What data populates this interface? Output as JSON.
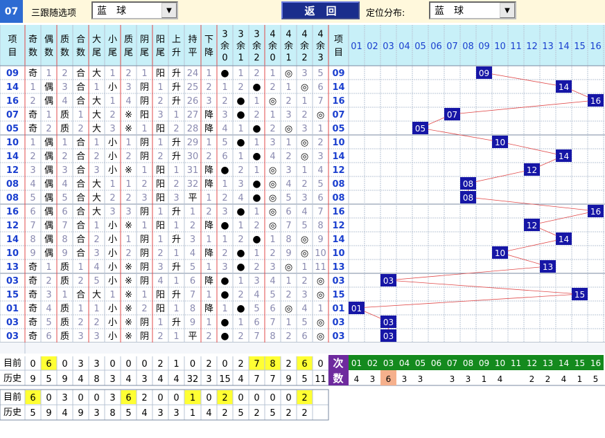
{
  "header": {
    "issue": "07",
    "filter1_label": "三跟随选项",
    "filter1_value": "蓝球",
    "back_label": "返回",
    "pos_label": "定位分布:",
    "pos_value": "蓝球"
  },
  "col_headers": [
    [
      "项",
      "目"
    ],
    [
      "奇",
      "数"
    ],
    [
      "偶",
      "数"
    ],
    [
      "质",
      "数"
    ],
    [
      "合",
      "数"
    ],
    [
      "大",
      "尾"
    ],
    [
      "小",
      "尾"
    ],
    [
      "质",
      "尾"
    ],
    [
      "阴",
      "尾"
    ],
    [
      "阳",
      "尾"
    ],
    [
      "上",
      "升"
    ],
    [
      "持",
      "平"
    ],
    [
      "下",
      "降"
    ],
    [
      "3",
      "余",
      "0"
    ],
    [
      "3",
      "余",
      "1"
    ],
    [
      "3",
      "余",
      "2"
    ],
    [
      "4",
      "余",
      "0"
    ],
    [
      "4",
      "余",
      "1"
    ],
    [
      "4",
      "余",
      "2"
    ],
    [
      "4",
      "余",
      "3"
    ],
    [
      "项",
      "目"
    ]
  ],
  "num_headers": [
    "01",
    "02",
    "03",
    "04",
    "05",
    "06",
    "07",
    "08",
    "09",
    "10",
    "11",
    "12",
    "13",
    "14",
    "15",
    "16"
  ],
  "rows": [
    [
      "09",
      "奇",
      "1",
      "2",
      "合",
      "大",
      "1",
      "2",
      "1",
      "阳",
      "升",
      "24",
      "1",
      "●",
      "1",
      "2",
      "1",
      "◎",
      "3",
      "5",
      "09"
    ],
    [
      "14",
      "1",
      "偶",
      "3",
      "合",
      "1",
      "小",
      "3",
      "阴",
      "1",
      "升",
      "25",
      "2",
      "1",
      "2",
      "●",
      "2",
      "1",
      "◎",
      "6",
      "14"
    ],
    [
      "16",
      "2",
      "偶",
      "4",
      "合",
      "大",
      "1",
      "4",
      "阴",
      "2",
      "升",
      "26",
      "3",
      "2",
      "●",
      "1",
      "◎",
      "2",
      "1",
      "7",
      "16"
    ],
    [
      "07",
      "奇",
      "1",
      "质",
      "1",
      "大",
      "2",
      "※",
      "阳",
      "3",
      "1",
      "27",
      "降",
      "3",
      "●",
      "2",
      "1",
      "3",
      "2",
      "◎",
      "07"
    ],
    [
      "05",
      "奇",
      "2",
      "质",
      "2",
      "大",
      "3",
      "※",
      "1",
      "阳",
      "2",
      "28",
      "降",
      "4",
      "1",
      "●",
      "2",
      "◎",
      "3",
      "1",
      "05"
    ],
    [
      "10",
      "1",
      "偶",
      "1",
      "合",
      "1",
      "小",
      "1",
      "阴",
      "1",
      "升",
      "29",
      "1",
      "5",
      "●",
      "1",
      "3",
      "1",
      "◎",
      "2",
      "10"
    ],
    [
      "14",
      "2",
      "偶",
      "2",
      "合",
      "2",
      "小",
      "2",
      "阴",
      "2",
      "升",
      "30",
      "2",
      "6",
      "1",
      "●",
      "4",
      "2",
      "◎",
      "3",
      "14"
    ],
    [
      "12",
      "3",
      "偶",
      "3",
      "合",
      "3",
      "小",
      "※",
      "1",
      "阳",
      "1",
      "31",
      "降",
      "●",
      "2",
      "1",
      "◎",
      "3",
      "1",
      "4",
      "12"
    ],
    [
      "08",
      "4",
      "偶",
      "4",
      "合",
      "大",
      "1",
      "1",
      "2",
      "阳",
      "2",
      "32",
      "降",
      "1",
      "3",
      "●",
      "◎",
      "4",
      "2",
      "5",
      "08"
    ],
    [
      "08",
      "5",
      "偶",
      "5",
      "合",
      "大",
      "2",
      "2",
      "3",
      "阳",
      "3",
      "平",
      "1",
      "2",
      "4",
      "●",
      "◎",
      "5",
      "3",
      "6",
      "08"
    ],
    [
      "16",
      "6",
      "偶",
      "6",
      "合",
      "大",
      "3",
      "3",
      "阴",
      "1",
      "升",
      "1",
      "2",
      "3",
      "●",
      "1",
      "◎",
      "6",
      "4",
      "7",
      "16"
    ],
    [
      "12",
      "7",
      "偶",
      "7",
      "合",
      "1",
      "小",
      "※",
      "1",
      "阳",
      "1",
      "2",
      "降",
      "●",
      "1",
      "2",
      "◎",
      "7",
      "5",
      "8",
      "12"
    ],
    [
      "14",
      "8",
      "偶",
      "8",
      "合",
      "2",
      "小",
      "1",
      "阴",
      "1",
      "升",
      "3",
      "1",
      "1",
      "2",
      "●",
      "1",
      "8",
      "◎",
      "9",
      "14"
    ],
    [
      "10",
      "9",
      "偶",
      "9",
      "合",
      "3",
      "小",
      "2",
      "阴",
      "2",
      "1",
      "4",
      "降",
      "2",
      "●",
      "1",
      "2",
      "9",
      "◎",
      "10",
      "10"
    ],
    [
      "13",
      "奇",
      "1",
      "质",
      "1",
      "4",
      "小",
      "※",
      "阴",
      "3",
      "升",
      "5",
      "1",
      "3",
      "●",
      "2",
      "3",
      "◎",
      "1",
      "11",
      "13"
    ],
    [
      "03",
      "奇",
      "2",
      "质",
      "2",
      "5",
      "小",
      "※",
      "阴",
      "4",
      "1",
      "6",
      "降",
      "●",
      "1",
      "3",
      "4",
      "1",
      "2",
      "◎",
      "03"
    ],
    [
      "15",
      "奇",
      "3",
      "1",
      "合",
      "大",
      "1",
      "※",
      "1",
      "阳",
      "升",
      "7",
      "1",
      "●",
      "2",
      "4",
      "5",
      "2",
      "3",
      "◎",
      "15"
    ],
    [
      "01",
      "奇",
      "4",
      "质",
      "1",
      "1",
      "小",
      "※",
      "2",
      "阳",
      "1",
      "8",
      "降",
      "1",
      "●",
      "5",
      "6",
      "◎",
      "4",
      "1",
      "01"
    ],
    [
      "03",
      "奇",
      "5",
      "质",
      "2",
      "2",
      "小",
      "※",
      "阴",
      "1",
      "升",
      "9",
      "1",
      "●",
      "1",
      "6",
      "7",
      "1",
      "5",
      "◎",
      "03"
    ],
    [
      "03",
      "奇",
      "6",
      "质",
      "3",
      "3",
      "小",
      "※",
      "阴",
      "2",
      "1",
      "平",
      "2",
      "●",
      "2",
      "7",
      "8",
      "2",
      "6",
      "◎",
      "03"
    ]
  ],
  "bottom": {
    "cur_label": "目前",
    "hist_label": "历史",
    "count_label1": "次",
    "count_label2": "数",
    "cur1": [
      "0",
      "6",
      "0",
      "3",
      "3",
      "0",
      "0",
      "0",
      "2",
      "1",
      "0",
      "2",
      "0",
      "2",
      "7",
      "8",
      "2",
      "6",
      "0"
    ],
    "hist1": [
      "9",
      "5",
      "9",
      "4",
      "8",
      "3",
      "4",
      "3",
      "4",
      "4",
      "32",
      "3",
      "15",
      "4",
      "7",
      "7",
      "9",
      "5",
      "11"
    ],
    "hl1": [
      1,
      14,
      15,
      17
    ],
    "dist_nums": [
      "01",
      "02",
      "03",
      "04",
      "05",
      "06",
      "07",
      "08",
      "09",
      "10",
      "11",
      "12",
      "13",
      "14",
      "15",
      "16"
    ],
    "dist_counts": [
      "4",
      "3",
      "6",
      "3",
      "3",
      "",
      "3",
      "3",
      "1",
      "4",
      "",
      "2",
      "2",
      "4",
      "1",
      "5"
    ],
    "cur2": [
      "6",
      "0",
      "3",
      "0",
      "0",
      "3",
      "6",
      "2",
      "0",
      "0",
      "1",
      "0",
      "2",
      "0",
      "0",
      "0",
      "0",
      "2"
    ],
    "hist2": [
      "5",
      "9",
      "4",
      "9",
      "3",
      "8",
      "5",
      "4",
      "3",
      "3",
      "1",
      "4",
      "2",
      "5",
      "2",
      "5",
      "2",
      "2"
    ],
    "hl2": [
      0,
      6,
      10,
      12,
      17
    ]
  },
  "colors": {
    "header_bg": "#c8f0f8",
    "blue_text": "#1a3fcf",
    "selected": "#1616a6",
    "grid": "#b8c4d4",
    "sep": "#e04848",
    "yellow": "#ffff33",
    "dist_bg": "#148a1e",
    "purple": "#6e2a9e",
    "salmon": "#f5b08c"
  }
}
